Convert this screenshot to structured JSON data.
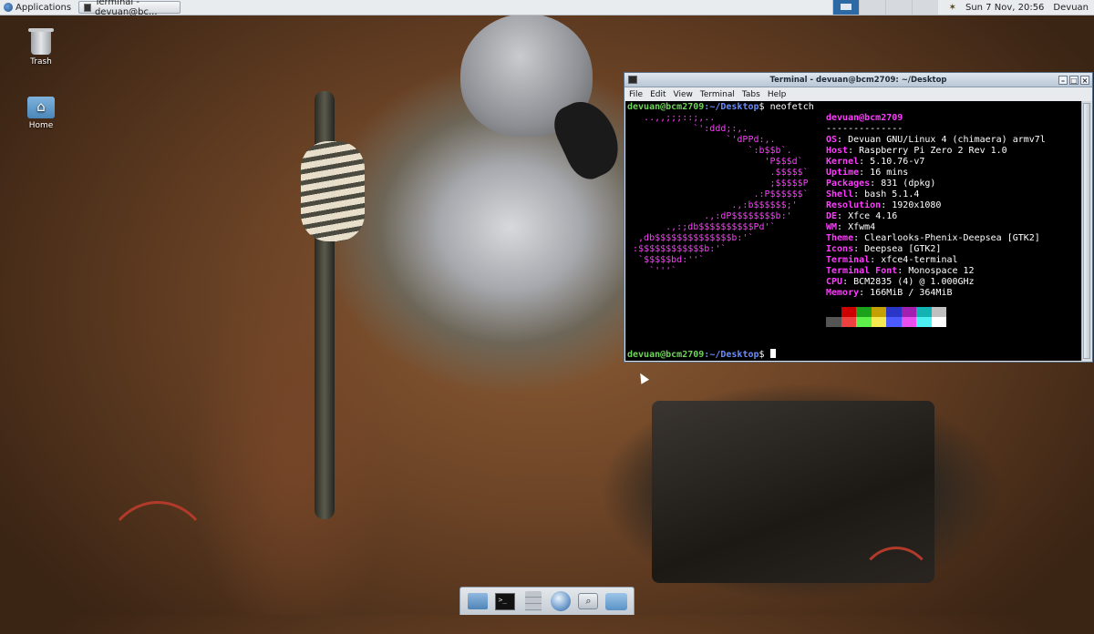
{
  "top_panel": {
    "applications_label": "Applications",
    "task_label": "Terminal - devuan@bc...",
    "clock": "Sun 7 Nov, 20:56",
    "user": "Devuan"
  },
  "desktop_icons": {
    "trash_label": "Trash",
    "home_label": "Home"
  },
  "terminal": {
    "title": "Terminal - devuan@bcm2709: ~/Desktop",
    "menu": [
      "File",
      "Edit",
      "View",
      "Terminal",
      "Tabs",
      "Help"
    ],
    "prompt_user": "devuan@bcm2709",
    "prompt_path": ":~/Desktop",
    "prompt_dollar": "$",
    "command": " neofetch",
    "ascii_art": [
      "   ..,,;;;::;,..",
      "            `':ddd;:,.",
      "                  `'dPPd:,.",
      "                      `:b$$b`.",
      "                         'P$$$d`",
      "                          .$$$$$`",
      "                          ;$$$$$P",
      "                       .:P$$$$$$`",
      "                   .,:b$$$$$$;'",
      "              .,:dP$$$$$$$$b:'",
      "       .,:;db$$$$$$$$$$Pd'`",
      "  ,db$$$$$$$$$$$$$$b:'`",
      " :$$$$$$$$$$$$b:'`",
      "  `$$$$$bd:''`",
      "    `'''`"
    ],
    "header_user": "devuan@bcm2709",
    "separator": "--------------",
    "info": [
      {
        "key": "OS",
        "value": "Devuan GNU/Linux 4 (chimaera) armv7l"
      },
      {
        "key": "Host",
        "value": "Raspberry Pi Zero 2 Rev 1.0"
      },
      {
        "key": "Kernel",
        "value": "5.10.76-v7"
      },
      {
        "key": "Uptime",
        "value": "16 mins"
      },
      {
        "key": "Packages",
        "value": "831 (dpkg)"
      },
      {
        "key": "Shell",
        "value": "bash 5.1.4"
      },
      {
        "key": "Resolution",
        "value": "1920x1080"
      },
      {
        "key": "DE",
        "value": "Xfce 4.16"
      },
      {
        "key": "WM",
        "value": "Xfwm4"
      },
      {
        "key": "Theme",
        "value": "Clearlooks-Phenix-Deepsea [GTK2]"
      },
      {
        "key": "Icons",
        "value": "Deepsea [GTK2]"
      },
      {
        "key": "Terminal",
        "value": "xfce4-terminal"
      },
      {
        "key": "Terminal Font",
        "value": "Monospace 12"
      },
      {
        "key": "CPU",
        "value": "BCM2835 (4) @ 1.000GHz"
      },
      {
        "key": "Memory",
        "value": "166MiB / 364MiB"
      }
    ],
    "palette_top": [
      "#000000",
      "#cc0000",
      "#1ca11c",
      "#c4a000",
      "#2a36c8",
      "#a31fb0",
      "#12b3b3",
      "#c0c0c0"
    ],
    "palette_bottom": [
      "#555555",
      "#ef4040",
      "#5df04a",
      "#f4ea4f",
      "#4b5bff",
      "#e94fef",
      "#4df0f0",
      "#ffffff"
    ]
  },
  "colors": {
    "prompt_green": "#6fd35a",
    "prompt_blue": "#6a8cff",
    "accent_magenta": "#ff3cff"
  }
}
